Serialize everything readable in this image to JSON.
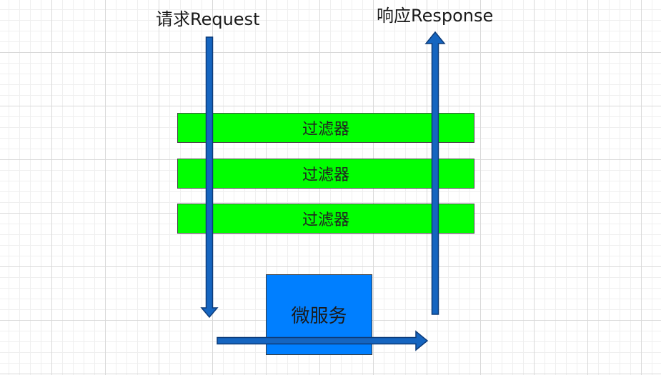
{
  "labels": {
    "request": "请求Request",
    "response": "响应Response"
  },
  "filters": [
    {
      "label": "过滤器"
    },
    {
      "label": "过滤器"
    },
    {
      "label": "过滤器"
    }
  ],
  "microservice": {
    "label": "微服务"
  },
  "colors": {
    "filter_fill": "#00ff00",
    "microservice_fill": "#007fff",
    "arrow_fill": "#1565c0",
    "arrow_stroke": "#0d3c7a"
  },
  "arrows": [
    {
      "name": "request-arrow",
      "direction": "down"
    },
    {
      "name": "response-arrow",
      "direction": "up"
    },
    {
      "name": "forward-arrow",
      "direction": "right"
    }
  ]
}
